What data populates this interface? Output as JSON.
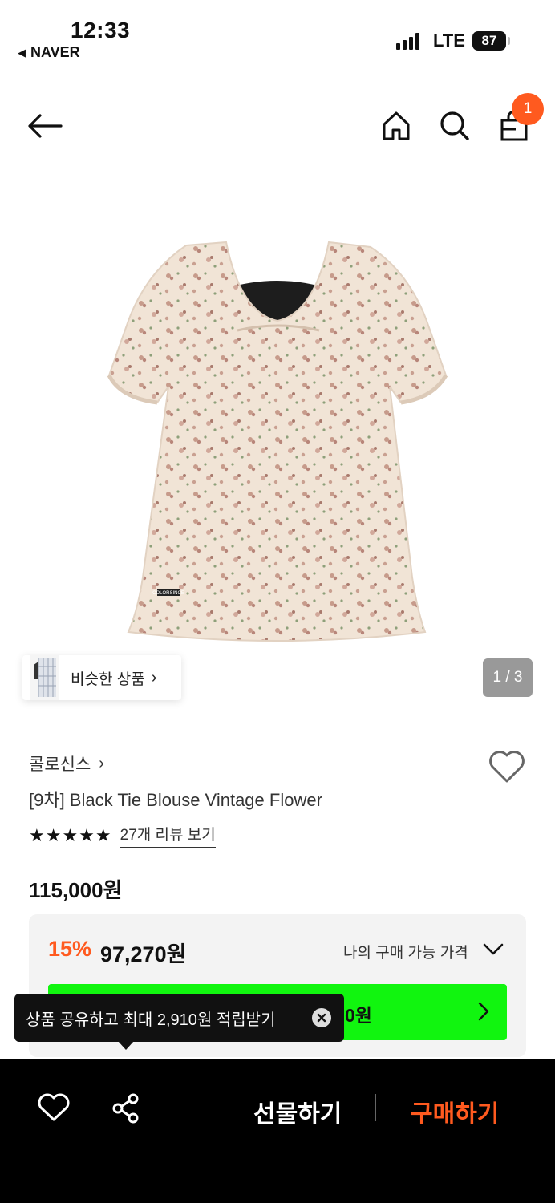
{
  "status_bar": {
    "time": "12:33",
    "back_app": "NAVER",
    "network": "LTE",
    "battery": "87"
  },
  "header": {
    "cart_count": "1"
  },
  "gallery": {
    "similar_label": "비슷한 상품",
    "page_indicator": "1 / 3",
    "garment_label_text": "COLORSINCE"
  },
  "product": {
    "brand": "콜로신스",
    "title": "[9차] Black Tie Blouse Vintage Flower",
    "rating_stars": "★★★★★",
    "review_link": "27개 리뷰 보기",
    "original_price": "115,000원"
  },
  "price_box": {
    "discount_rate": "15%",
    "discount_price": "97,270원",
    "my_price_label": "나의 구매 가능 가격",
    "naver_button_visible_text": "0원"
  },
  "tooltip": {
    "text": "상품 공유하고 최대 2,910원 적립받기"
  },
  "bottom_bar": {
    "gift_label": "선물하기",
    "buy_label": "구매하기"
  },
  "colors": {
    "accent": "#ff5a1f",
    "naver_green": "#11f50f",
    "bottom_bar": "#000000"
  }
}
